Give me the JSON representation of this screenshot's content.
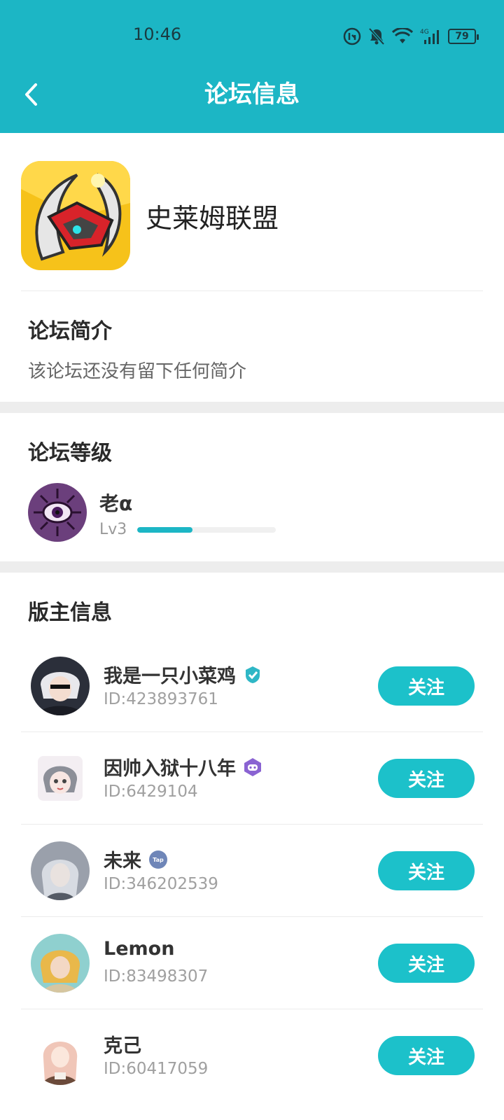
{
  "status_bar": {
    "time": "10:46",
    "network": "4G",
    "battery": "79"
  },
  "header": {
    "title": "论坛信息"
  },
  "forum": {
    "name": "史莱姆联盟"
  },
  "intro": {
    "title": "论坛简介",
    "text": "该论坛还没有留下任何简介"
  },
  "level": {
    "title": "论坛等级",
    "name": "老α",
    "lv": "Lv3",
    "progress": 0.4
  },
  "moderators": {
    "title": "版主信息",
    "list": [
      {
        "name": "我是一只小菜鸡",
        "id": "ID:423893761",
        "badge": "verified-badge-icon",
        "follow": "关注"
      },
      {
        "name": "因帅入狱十八年",
        "id": "ID:6429104",
        "badge": "game-badge-icon",
        "follow": "关注"
      },
      {
        "name": "未来",
        "id": "ID:346202539",
        "badge": "tap-badge-icon",
        "follow": "关注"
      },
      {
        "name": "Lemon",
        "id": "ID:83498307",
        "badge": "",
        "follow": "关注"
      },
      {
        "name": "克己",
        "id": "ID:60417059",
        "badge": "",
        "follow": "关注"
      }
    ]
  },
  "colors": {
    "accent": "#1cb6c5",
    "button": "#1cc1ca",
    "verified": "#2fb7c6",
    "game": "#8a63d2",
    "tap": "#6f86b8"
  }
}
